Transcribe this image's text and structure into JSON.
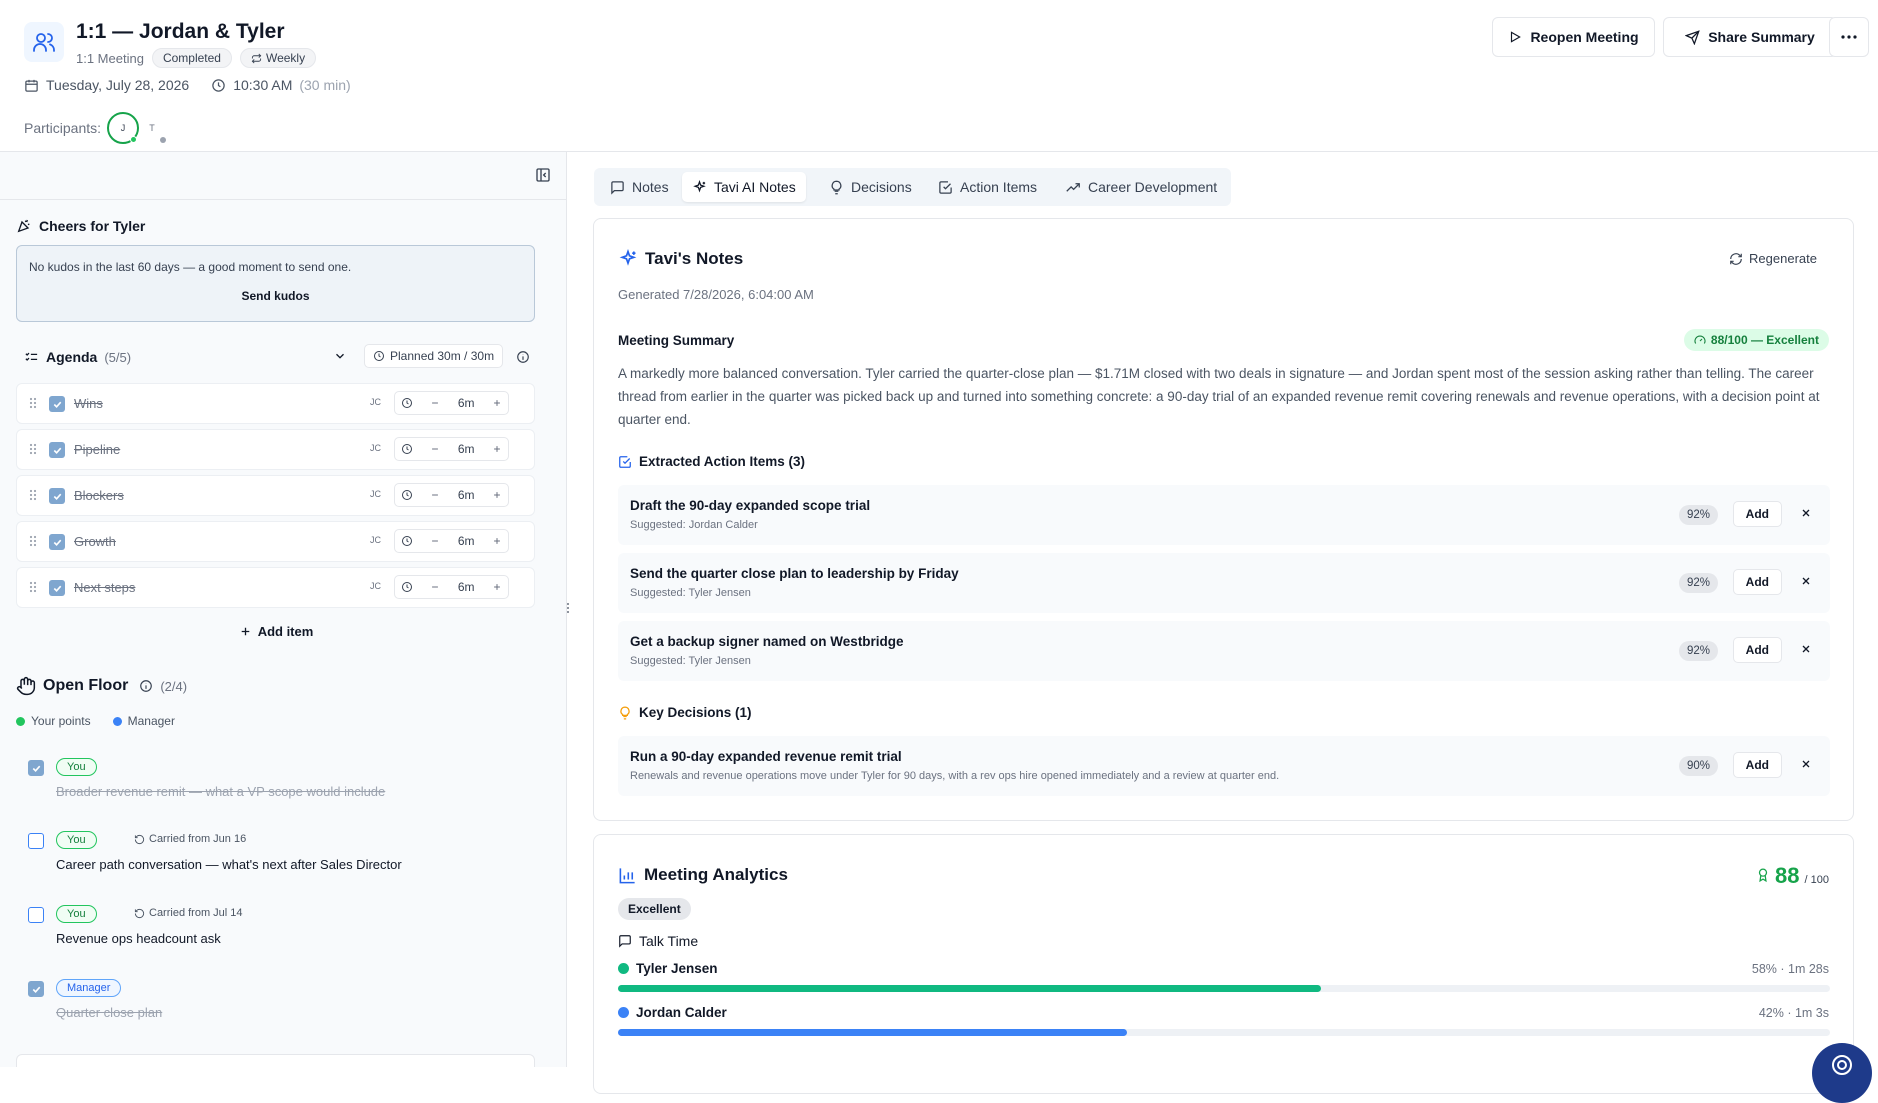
{
  "header": {
    "title": "1:1 — Jordan & Tyler",
    "meeting_type": "1:1 Meeting",
    "status": "Completed",
    "recurrence": "Weekly",
    "date": "Tuesday, July 28, 2026",
    "time": "10:30 AM",
    "duration": "(30 min)",
    "participants_label": "Participants:",
    "participants": [
      "J",
      "T"
    ],
    "reopen_label": "Reopen Meeting",
    "share_label": "Share Summary"
  },
  "cheers": {
    "title": "Cheers for Tyler",
    "message": "No kudos in the last 60 days — a good moment to send one.",
    "send_label": "Send kudos"
  },
  "agenda": {
    "title": "Agenda",
    "count": "(5/5)",
    "planned": "Planned 30m / 30m",
    "add_label": "Add item",
    "items": [
      {
        "label": "Wins",
        "initials": "JC",
        "time": "6m"
      },
      {
        "label": "Pipeline",
        "initials": "JC",
        "time": "6m"
      },
      {
        "label": "Blockers",
        "initials": "JC",
        "time": "6m"
      },
      {
        "label": "Growth",
        "initials": "JC",
        "time": "6m"
      },
      {
        "label": "Next steps",
        "initials": "JC",
        "time": "6m"
      }
    ]
  },
  "open_floor": {
    "title": "Open Floor",
    "count": "(2/4)",
    "legend_you": "Your points",
    "legend_manager": "Manager",
    "items": [
      {
        "tag": "You",
        "carried": "",
        "text": "Broader revenue remit — what a VP scope would include",
        "done": true
      },
      {
        "tag": "You",
        "carried": "Carried from Jun 16",
        "text": "Career path conversation — what's next after Sales Director",
        "done": false
      },
      {
        "tag": "You",
        "carried": "Carried from Jul 14",
        "text": "Revenue ops headcount ask",
        "done": false
      },
      {
        "tag": "Manager",
        "carried": "",
        "text": "Quarter close plan",
        "done": true
      }
    ]
  },
  "tabs": [
    "Notes",
    "Tavi AI Notes",
    "Decisions",
    "Action Items",
    "Career Development"
  ],
  "ai_notes": {
    "title": "Tavi's Notes",
    "regenerate_label": "Regenerate",
    "generated": "Generated 7/28/2026, 6:04:00 AM",
    "summary_title": "Meeting Summary",
    "score_badge": "88/100 — Excellent",
    "summary": "A markedly more balanced conversation. Tyler carried the quarter-close plan — $1.71M closed with two deals in signature — and Jordan spent most of the session asking rather than telling. The career thread from earlier in the quarter was picked back up and turned into something concrete: a 90-day trial of an expanded revenue remit covering renewals and revenue operations, with a decision point at quarter end.",
    "action_items_title": "Extracted Action Items (3)",
    "action_items": [
      {
        "title": "Draft the 90-day expanded scope trial",
        "sub": "Suggested: Jordan Calder",
        "pct": "92%"
      },
      {
        "title": "Send the quarter close plan to leadership by Friday",
        "sub": "Suggested: Tyler Jensen",
        "pct": "92%"
      },
      {
        "title": "Get a backup signer named on Westbridge",
        "sub": "Suggested: Tyler Jensen",
        "pct": "92%"
      }
    ],
    "decisions_title": "Key Decisions (1)",
    "decisions": [
      {
        "title": "Run a 90-day expanded revenue remit trial",
        "sub": "Renewals and revenue operations move under Tyler for 90 days, with a rev ops hire opened immediately and a review at quarter end.",
        "pct": "90%"
      }
    ],
    "add_label": "Add"
  },
  "analytics": {
    "title": "Meeting Analytics",
    "score": "88",
    "score_max": "/ 100",
    "rating": "Excellent",
    "talk_time_title": "Talk Time",
    "talk": [
      {
        "name": "Tyler Jensen",
        "stat": "58% · 1m 28s",
        "percent": 58,
        "color": "#10b981"
      },
      {
        "name": "Jordan Calder",
        "stat": "42% · 1m 3s",
        "percent": 42,
        "color": "#3b82f6"
      }
    ]
  }
}
